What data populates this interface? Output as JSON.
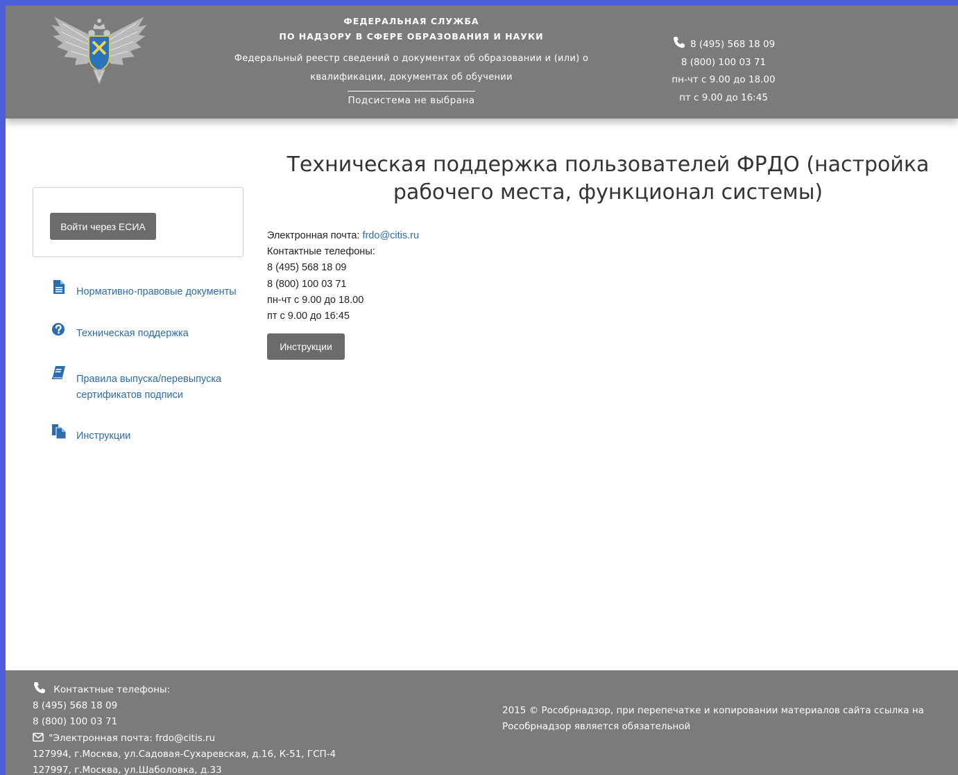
{
  "header": {
    "agency_line1": "ФЕДЕРАЛЬНАЯ СЛУЖБА",
    "agency_line2": "ПО НАДЗОРУ В СФЕРЕ ОБРАЗОВАНИЯ И НАУКИ",
    "registry_line1": "Федеральный реестр сведений о документах об образовании и (или) о",
    "registry_line2": "квалификации, документах об обучении",
    "subsystem": "Подсистема не выбрана",
    "phone1": "8 (495) 568 18 09",
    "phone2": "8 (800) 100 03 71",
    "hours1": "пн-чт с 9.00 до 18.00",
    "hours2": "пт с 9.00 до 16:45"
  },
  "sidebar": {
    "login_button": "Войти через ЕСИА",
    "items": [
      {
        "label": "Нормативно-правовые документы",
        "icon": "document-icon"
      },
      {
        "label": "Техническая поддержка",
        "icon": "question-circle-icon"
      },
      {
        "label_line1": "Правила выпуска/перевыпуска",
        "label_line2": "сертификатов подписи",
        "icon": "book-icon"
      },
      {
        "label": "Инструкции",
        "icon": "copy-files-icon"
      }
    ]
  },
  "main": {
    "title_line1": "Техническая поддержка пользователей ФРДО (настройка",
    "title_line2": "рабочего места, функционал системы)",
    "email_label": "Электронная почта: ",
    "email": "frdo@citis.ru",
    "phones_label": "Контактные телефоны:",
    "phone1": "8 (495) 568 18 09",
    "phone2": "8 (800) 100 03 71",
    "hours1": "пн-чт с 9.00 до 18.00",
    "hours2": "пт с 9.00 до 16:45",
    "instructions_button": "Инструкции"
  },
  "footer": {
    "phones_label": "Контактные телефоны:",
    "phone1": "8 (495) 568 18 09",
    "phone2": "8 (800) 100 03 71",
    "email_line": "\"Электронная почта: frdo@citis.ru",
    "address1": "127994, г.Москва, ул.Садовая-Сухаревская, д.16, К-51, ГСП-4",
    "address2": "127997, г.Москва, ул.Шаболовка, д.33",
    "copyright_line1": "2015 © Рособрнадзор, при перепечатке и копировании материалов сайта ссылка на",
    "copyright_line2": "Рособрнадзор является обязательной"
  },
  "colors": {
    "page_border": "#4a5fd8",
    "header_bg": "#7b7b7b",
    "button_bg": "#6b6b6b",
    "link": "#2b6cb0"
  }
}
